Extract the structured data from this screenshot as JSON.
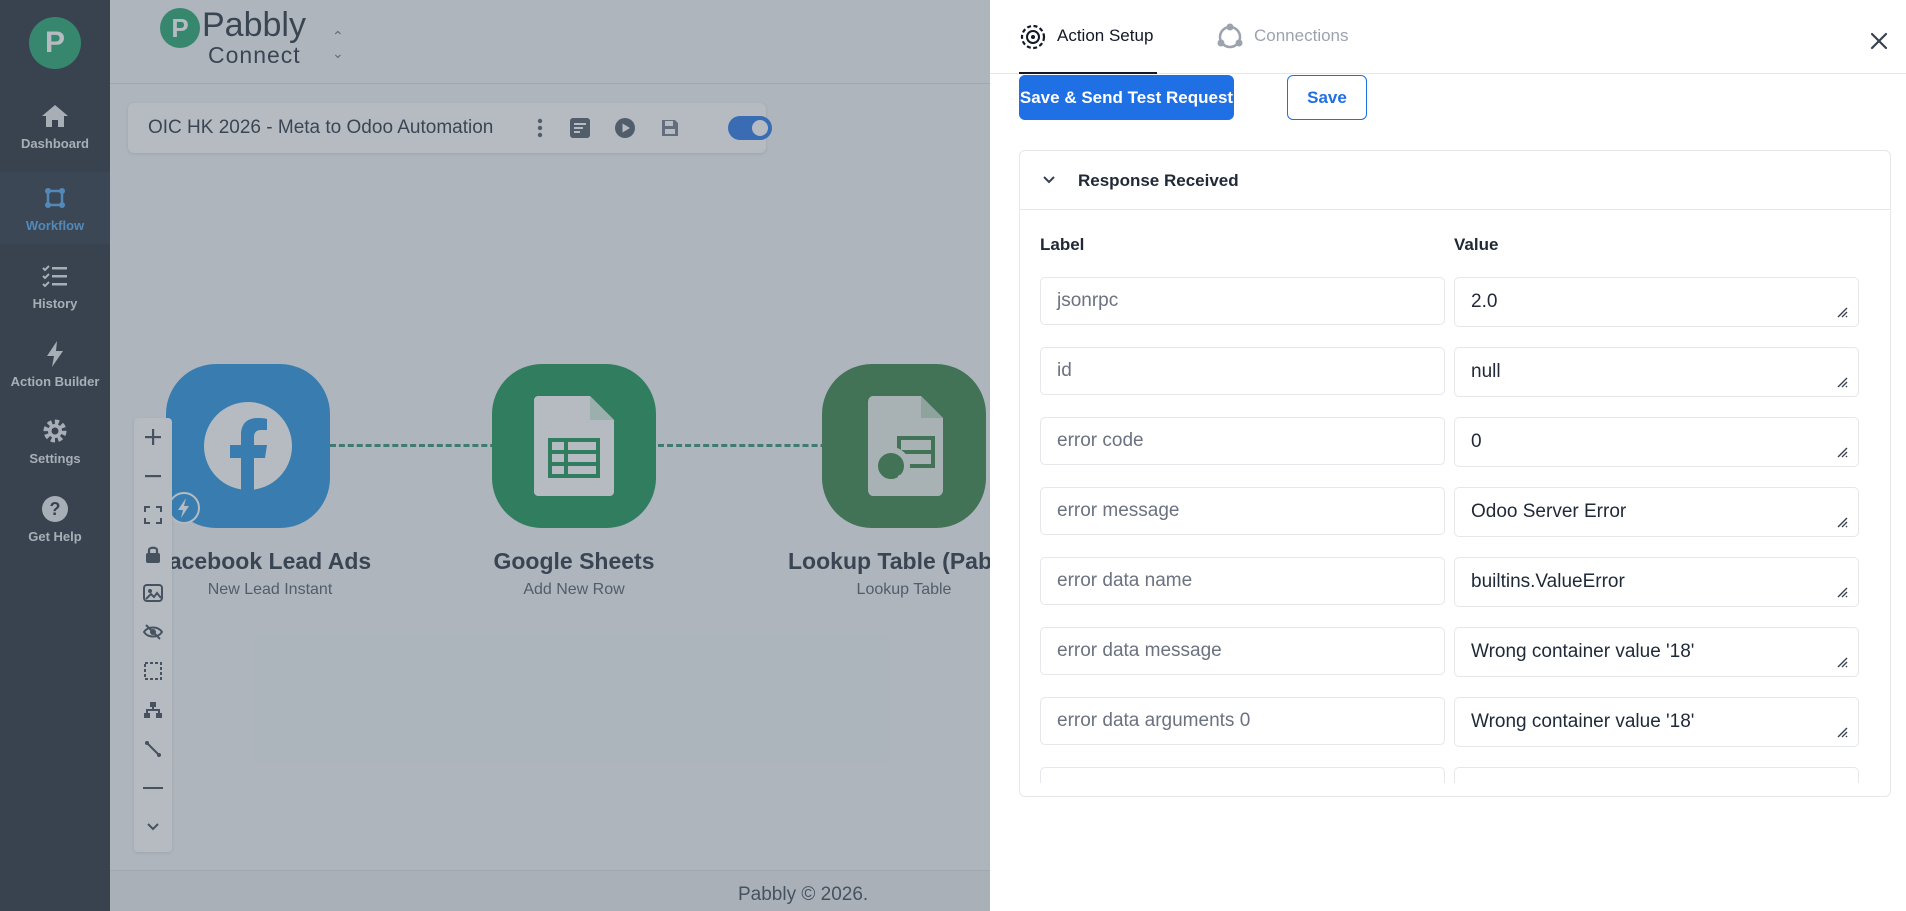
{
  "sidebar": {
    "logo": "P",
    "items": [
      {
        "label": "Dashboard",
        "icon": "home-icon"
      },
      {
        "label": "Workflow",
        "icon": "workflow-icon"
      },
      {
        "label": "History",
        "icon": "history-icon"
      },
      {
        "label": "Action Builder",
        "icon": "bolt-icon"
      },
      {
        "label": "Settings",
        "icon": "gear-icon"
      },
      {
        "label": "Get Help",
        "icon": "help-icon"
      }
    ],
    "active_index": 1
  },
  "brand": {
    "mark": "P",
    "word1": "Pabbly",
    "word2": "Connect"
  },
  "workflow": {
    "title": "OIC HK 2026 - Meta to Odoo Automation"
  },
  "nodes": [
    {
      "title": "acebook Lead Ads",
      "subtitle": "New Lead Instant",
      "color": "#1e8fe1"
    },
    {
      "title": "Google Sheets",
      "subtitle": "Add New Row",
      "color": "#0f8f4f"
    },
    {
      "title": "Lookup Table (Pab",
      "subtitle": "Lookup Table",
      "color": "#2e7d3d"
    }
  ],
  "footer": {
    "text": "Pabbly © 2026."
  },
  "drawer": {
    "tabs": [
      {
        "label": "Action Setup",
        "icon": "gear-icon",
        "active": true
      },
      {
        "label": "Connections",
        "icon": "connections-icon",
        "active": false
      }
    ],
    "buttons": {
      "primary": "Save & Send Test Request",
      "secondary": "Save"
    },
    "response": {
      "title": "Response Received",
      "columns": {
        "label": "Label",
        "value": "Value"
      },
      "rows": [
        {
          "label": "jsonrpc",
          "value": "2.0"
        },
        {
          "label": "id",
          "value": "null"
        },
        {
          "label": "error code",
          "value": "0"
        },
        {
          "label": "error message",
          "value": "Odoo Server Error"
        },
        {
          "label": "error data name",
          "value": "builtins.ValueError"
        },
        {
          "label": "error data message",
          "value": "Wrong container value '18'"
        },
        {
          "label": "error data arguments 0",
          "value": "Wrong container value '18'"
        }
      ]
    }
  },
  "colors": {
    "accent": "#1f6fe5",
    "sidebar_bg": "#1c2530",
    "brand_green": "#1aa06b"
  }
}
